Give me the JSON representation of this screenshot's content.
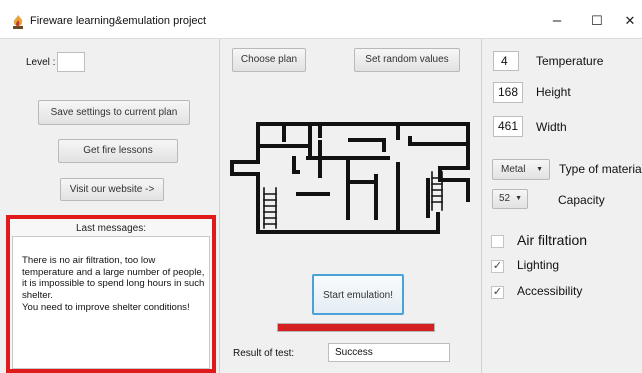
{
  "window": {
    "title": "Fireware learning&emulation project",
    "controls": {
      "minimize": "–",
      "maximize": "☐",
      "close": "✕"
    }
  },
  "left_panel": {
    "level_label": "Level :",
    "level_value": "",
    "save_button": "Save settings to current plan",
    "lessons_button": "Get fire lessons",
    "website_button": "Visit our website ->",
    "messages_title": "Last messages:",
    "messages_text": "There is no air filtration, too low temperature and a large number of people, it is impossible to spend long hours in such shelter.\nYou need to improve shelter conditions!"
  },
  "center_panel": {
    "choose_plan_button": "Choose plan",
    "random_values_button": "Set random  values",
    "start_button": "Start emulation!",
    "progress": 1.0,
    "progress_color": "#d42020",
    "result_label": "Result of test:",
    "result_value": "Success"
  },
  "right_panel": {
    "temperature": {
      "value": "4",
      "label": "Temperature"
    },
    "height": {
      "value": "168",
      "label": "Height"
    },
    "width": {
      "value": "461",
      "label": "Width"
    },
    "material": {
      "value": "Metal",
      "label": "Type of materia"
    },
    "capacity": {
      "value": "52",
      "label": "Capacity"
    },
    "checks": [
      {
        "label": "Air filtration",
        "checked": false
      },
      {
        "label": "Lighting",
        "checked": true
      },
      {
        "label": "Accessibility",
        "checked": true
      }
    ]
  },
  "colors": {
    "accent_red": "#e01a1a",
    "start_border": "#4aa3d8"
  }
}
